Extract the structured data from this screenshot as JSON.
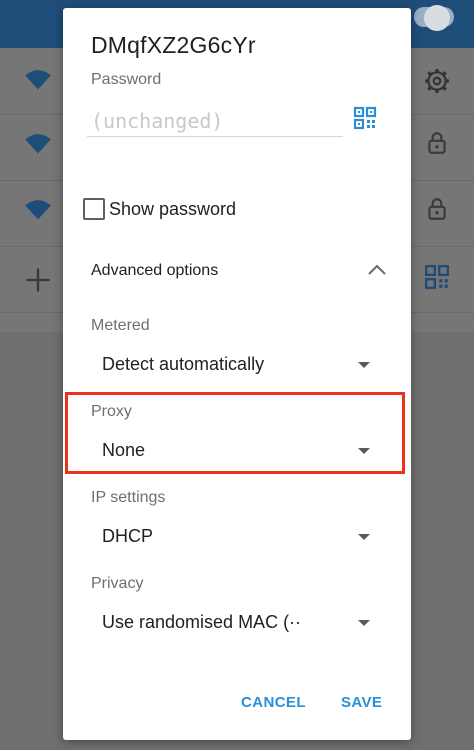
{
  "colors": {
    "accent": "#2a8fd6",
    "highlight": "#e8321c",
    "topbar": "#1f4d7a"
  },
  "dialog": {
    "title": "DMqfXZ2G6cYr",
    "password": {
      "label": "Password",
      "placeholder": "(unchanged)",
      "value": ""
    },
    "show_password": {
      "label": "Show password",
      "checked": false
    },
    "advanced_options": {
      "label": "Advanced options",
      "expanded": true
    },
    "metered": {
      "label": "Metered",
      "value": "Detect automatically"
    },
    "proxy": {
      "label": "Proxy",
      "value": "None"
    },
    "ip_settings": {
      "label": "IP settings",
      "value": "DHCP"
    },
    "privacy": {
      "label": "Privacy",
      "value": "Use randomised MAC (··"
    },
    "buttons": {
      "cancel": "CANCEL",
      "save": "SAVE"
    }
  },
  "icons": {
    "qr": "qr-code-icon",
    "chevron": "chevron-up-icon",
    "caret": "dropdown-caret-icon",
    "wifi": "wifi-icon",
    "lock": "lock-icon",
    "gear": "gear-icon",
    "add": "plus-icon"
  }
}
